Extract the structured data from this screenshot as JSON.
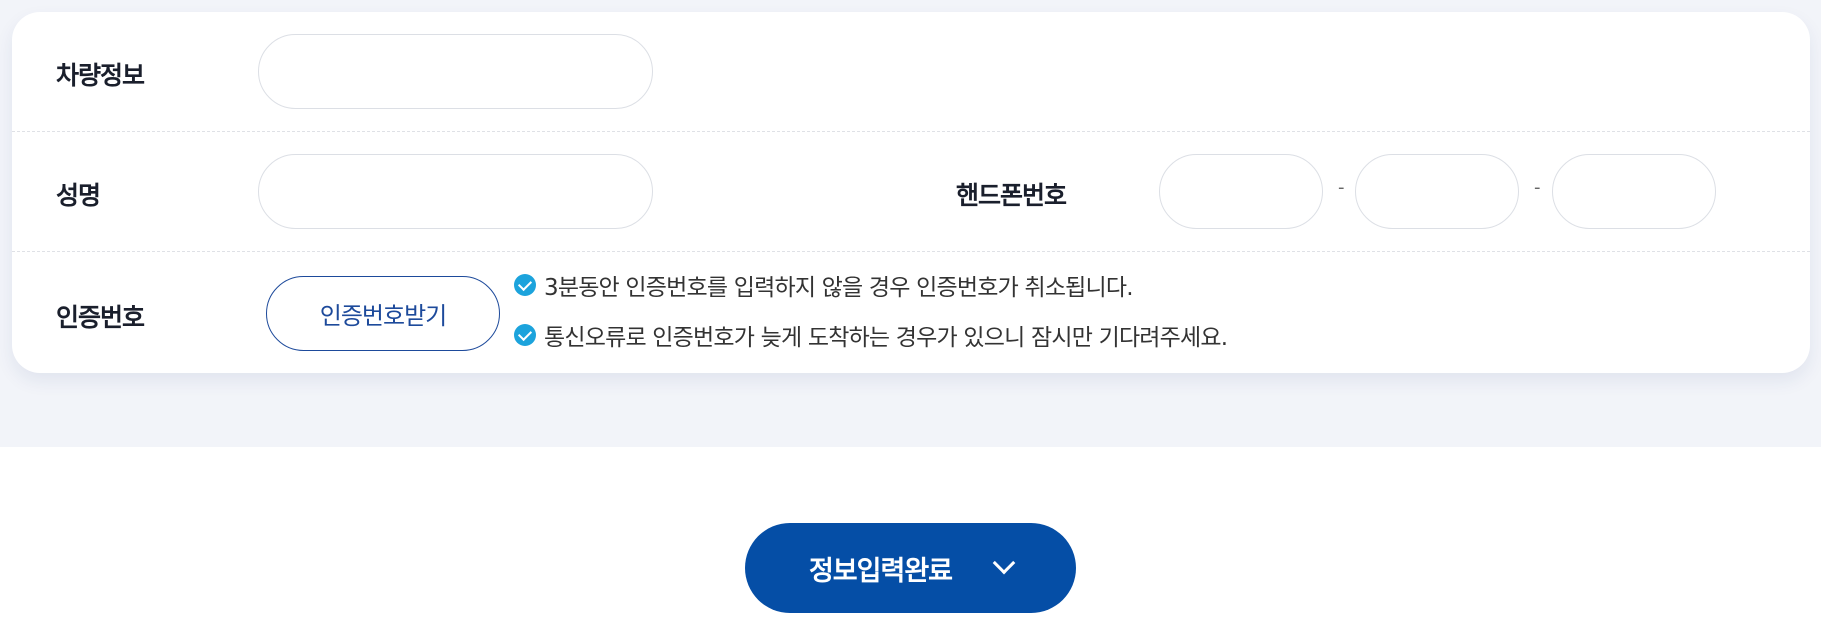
{
  "form": {
    "vehicle_label": "차량정보",
    "name_label": "성명",
    "phone_label": "핸드폰번호",
    "phone_separator": "-",
    "cert_label": "인증번호",
    "cert_button": "인증번호받기",
    "notices": [
      "3분동안 인증번호를 입력하지 않을 경우 인증번호가 취소됩니다.",
      "통신오류로 인증번호가 늦게 도착하는 경우가 있으니 잠시만 기다려주세요."
    ]
  },
  "submit": {
    "label": "정보입력완료",
    "icon": "chevron-down-icon"
  },
  "colors": {
    "primary": "#054ea6",
    "check": "#1ca3dc",
    "background": "#f2f4f9"
  }
}
